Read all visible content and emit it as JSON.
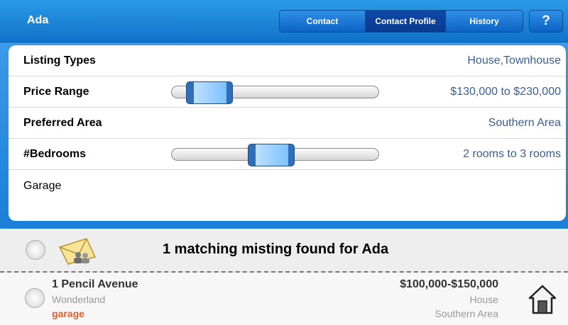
{
  "navbar": {
    "title": "Ada",
    "tabs": [
      {
        "label": "Contact",
        "active": false
      },
      {
        "label": "Contact Profile",
        "active": true
      },
      {
        "label": "History",
        "active": false
      }
    ],
    "help_label": "?"
  },
  "preferences": {
    "listing_types": {
      "label": "Listing Types",
      "value": "House,Townhouse"
    },
    "price_range": {
      "label": "Price Range",
      "value": "$130,000 to $230,000"
    },
    "preferred_area": {
      "label": "Preferred Area",
      "value": "Southern Area"
    },
    "bedrooms": {
      "label": "#Bedrooms",
      "value": "2 rooms to 3 rooms"
    },
    "garage": {
      "label": "Garage"
    }
  },
  "matches": {
    "summary": "1 matching misting found for Ada",
    "icon": "mail-contacts-icon",
    "listings": [
      {
        "address": "1 Pencil Avenue",
        "city": "Wonderland",
        "feature": "garage",
        "price": "$100,000-$150,000",
        "type": "House",
        "area": "Southern Area",
        "icon": "house-icon"
      }
    ]
  },
  "colors": {
    "nav_blue": "#1172c9",
    "value_text": "#3a5d96",
    "feature_orange": "#e35d26"
  }
}
